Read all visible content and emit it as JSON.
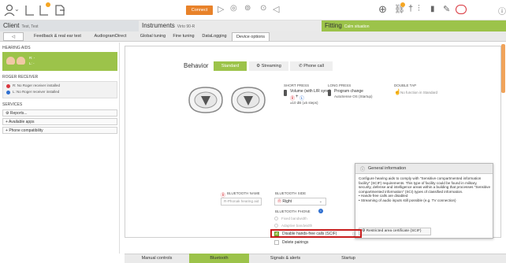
{
  "header": {
    "client_label": "Client",
    "client_name": "Test, Test",
    "instruments_label": "Instruments",
    "instruments_name": "Virto 90-R",
    "fitting_label": "Fitting",
    "fitting_situation": "Calm situation",
    "connect_label": "Connect"
  },
  "nav_tabs": {
    "back": "◁",
    "feedback": "Feedback & real ear test",
    "audiogram": "AudiogramDirect",
    "global": "Global tuning",
    "fine": "Fine tuning",
    "datalogging": "DataLogging",
    "device": "Device options"
  },
  "sidebar": {
    "hearing_aids_title": "HEARING AIDS",
    "ha_r": "R: -",
    "ha_l": "L: -",
    "roger_title": "ROGER RECEIVER",
    "roger_r": "R: No Roger receiver installed",
    "roger_l": "L: No Roger receiver installed",
    "services_title": "SERVICES",
    "reports": "Reports...",
    "apps": "Available apps",
    "phone": "Phone compatibility"
  },
  "behavior": {
    "label": "Behavior",
    "standard": "Standard",
    "streaming": "Streaming",
    "phone_call": "Phone call"
  },
  "short_press": {
    "title": "SHORT PRESS",
    "line1": "Volume (with L/R sync)",
    "line2": "±10 dB (±5 steps)"
  },
  "long_press": {
    "title": "LONG PRESS",
    "line1": "Program change",
    "line2": "AutoSense OS (Startup)"
  },
  "double_tap": {
    "title": "DOUBLE TAP",
    "line1": "No function in Standard"
  },
  "info": {
    "title": "General information",
    "body1": "Configure hearing aids to comply with \"Sensitive compartmented information facility\" (SCIF) requirements. This type of facility could be found in military, security, defense and intelligence areas within a building that processes \"Sensitive compartmented information\" (SCI) types of classified information.",
    "bullet1": "• Hands-free calls are disabled",
    "bullet2": "• Streaming of audio inputs still possible (e.g. TV connection)",
    "cert_button": "Restricted area certificate (SCIF)"
  },
  "bluetooth": {
    "name_title": "BLUETOOTH NAME",
    "name_placeholder": "R-Phonak hearing aid",
    "side_title": "BLUETOOTH SIDE",
    "side_value": "Right",
    "phone_title": "BLUETOOTH PHONE",
    "fixed_bw": "Fixed bandwidth",
    "adaptive_bw": "Adaptive bandwidth",
    "disable_hf": "Disable hands-free calls (SCIF)",
    "delete_pairings": "Delete pairings"
  },
  "bottom_tabs": {
    "manual": "Manual controls",
    "bluetooth": "Bluetooth",
    "signals": "Signals & alerts",
    "startup": "Startup"
  },
  "colors": {
    "accent_green": "#9cc34a",
    "connect_orange": "#e8822a",
    "highlight_red": "#c81e1e",
    "right_red": "#d9363e",
    "left_blue": "#2f6fd0"
  }
}
